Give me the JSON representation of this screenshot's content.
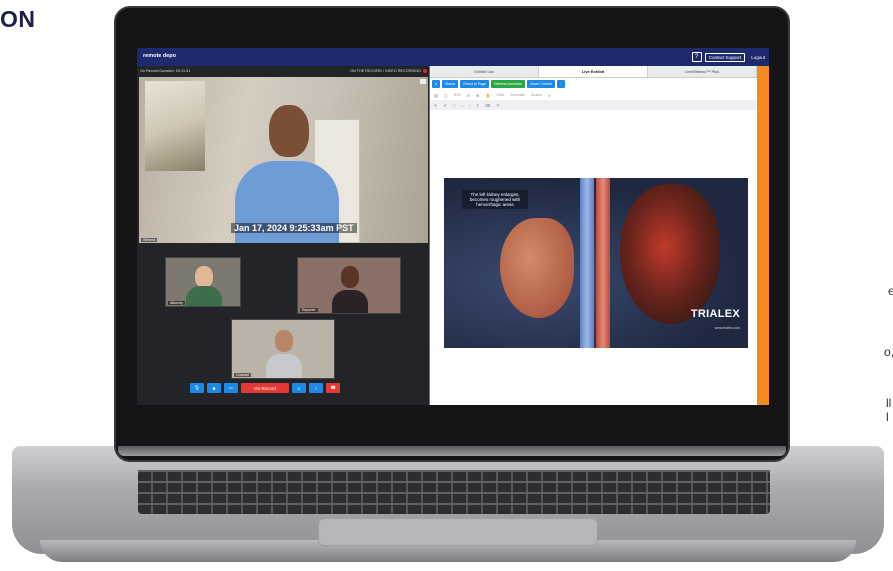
{
  "side_text": {
    "heading": "ON",
    "fragments": [
      "e",
      "o,",
      "ll",
      "l"
    ]
  },
  "app": {
    "logo": "remote depo",
    "help_label": "?",
    "contact_label": "Contact Support",
    "logout_label": "Logout"
  },
  "video": {
    "duration_label": "On Record Duration: 00:11:31",
    "recording_label": "ON THE RECORD / VIDEO RECORDING",
    "timestamp": "Jan 17, 2024  9:25:33am PST",
    "participants": [
      "Witness",
      "Attorney",
      "Reporter",
      "Counsel"
    ]
  },
  "controls": {
    "on_record_label": "On Record"
  },
  "exhibit": {
    "tabs": [
      "Exhibit List",
      "Live Exhibit",
      "LiveWitness™ Plus"
    ],
    "active_tab": 1,
    "toolbar": {
      "stamp_label": "Stamp",
      "direct_label": "Direct to Page",
      "witness_label": "Witness Annotate",
      "zoom_label": "Zoom Control"
    },
    "toolbar2_zoom": "90%",
    "toolbar2_field1": "Filter",
    "toolbar2_field2": "Annotate",
    "toolbar2_field3": "Search",
    "image_caption": "The left kidney enlarges, becomes roughened with hemorrhagic areas",
    "brand": "TRIALEX",
    "brand_url": "www.trialex.com"
  },
  "colors": {
    "header": "#1f2a6e",
    "accent_blue": "#1e88e5",
    "accent_green": "#27a844",
    "record_red": "#e53935",
    "side_strip": "#f58a1f"
  }
}
